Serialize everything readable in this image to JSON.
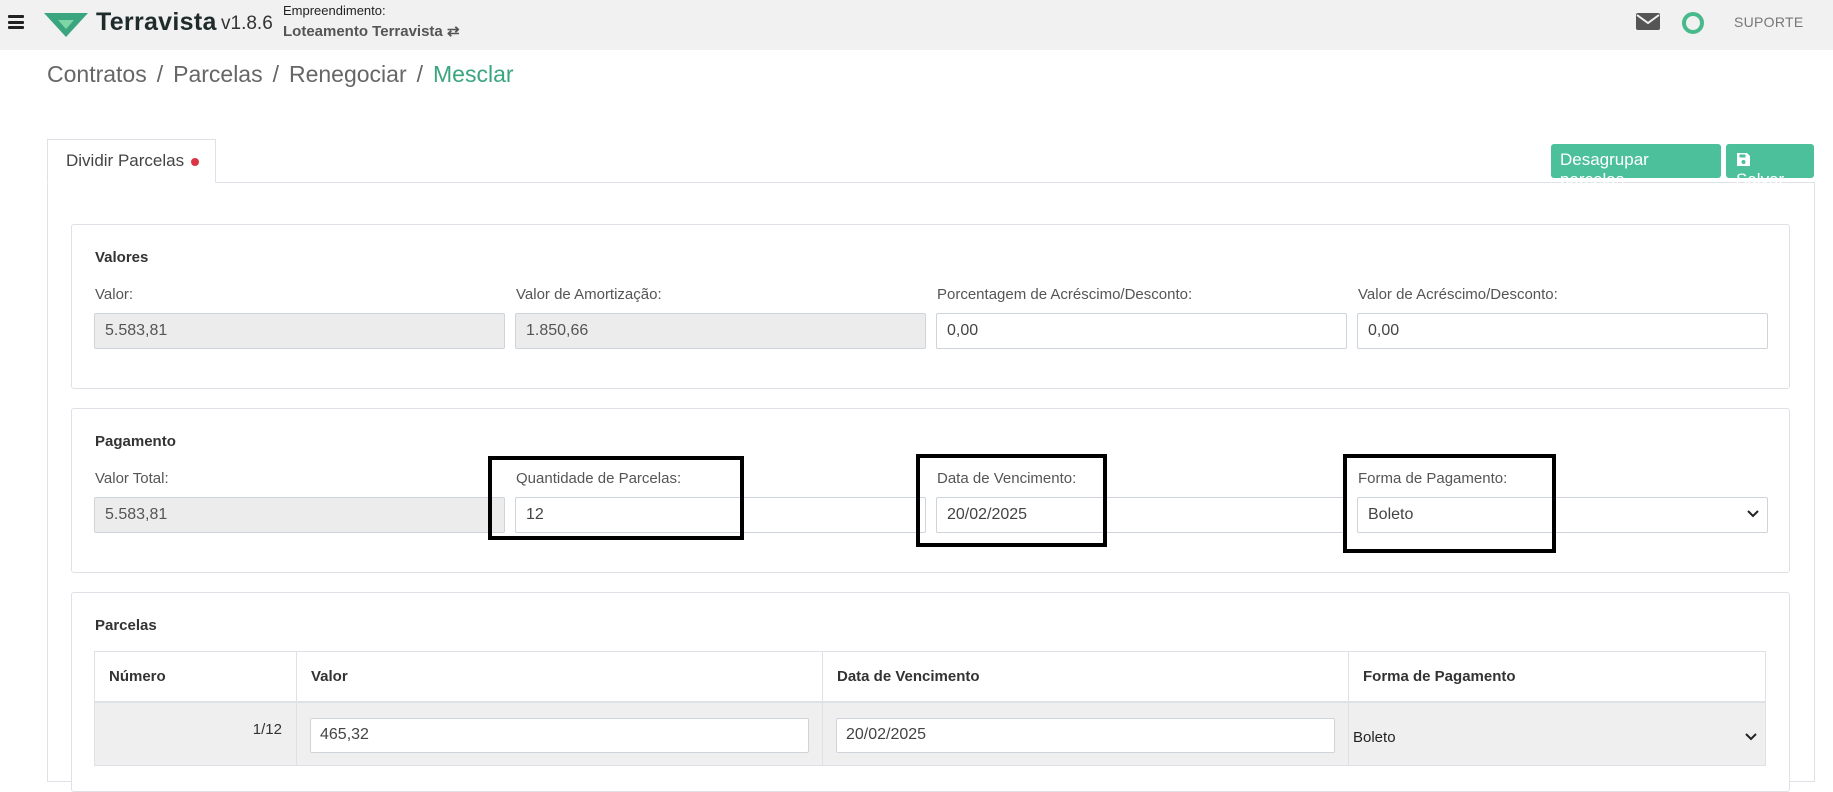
{
  "header": {
    "brand": "Terravista",
    "version": "v1.8.6",
    "empreendimento_label": "Empreendimento:",
    "empreendimento_value": "Loteamento Terravista ⇄",
    "support_label": "SUPORTE",
    "accent_color": "#48b98b"
  },
  "breadcrumb": {
    "items": [
      "Contratos",
      "Parcelas",
      "Renegociar",
      "Mesclar"
    ],
    "separator": "/"
  },
  "tab": {
    "label": "Dividir Parcelas"
  },
  "actions": {
    "ungroup_label": "Desagrupar parcelas",
    "save_label": "Salvar"
  },
  "valores": {
    "title": "Valores",
    "valor_label": "Valor:",
    "valor_value": "5.583,81",
    "amortizacao_label": "Valor de Amortização:",
    "amortizacao_value": "1.850,66",
    "porcentagem_label": "Porcentagem de Acréscimo/Desconto:",
    "porcentagem_value": "0,00",
    "acrescimo_label": "Valor de Acréscimo/Desconto:",
    "acrescimo_value": "0,00"
  },
  "pagamento": {
    "title": "Pagamento",
    "total_label": "Valor Total:",
    "total_value": "5.583,81",
    "quantidade_label": "Quantidade de Parcelas:",
    "quantidade_value": "12",
    "vencimento_label": "Data de Vencimento:",
    "vencimento_value": "20/02/2025",
    "forma_label": "Forma de Pagamento:",
    "forma_value": "Boleto"
  },
  "parcelas": {
    "title": "Parcelas",
    "columns": [
      "Número",
      "Valor",
      "Data de Vencimento",
      "Forma de Pagamento"
    ],
    "rows": [
      {
        "numero": "1/12",
        "valor": "465,32",
        "vencimento": "20/02/2025",
        "forma": "Boleto"
      }
    ]
  }
}
